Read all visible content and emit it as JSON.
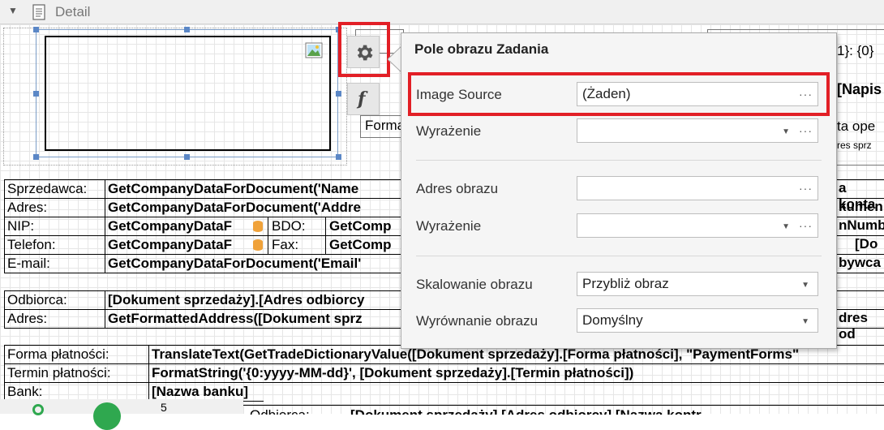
{
  "band": {
    "title": "Detail"
  },
  "right_fragments": {
    "line1": "1}: {0}",
    "line2": "[Napis",
    "line3": "ta ope",
    "line4": "res sprz",
    "r1": "a konta",
    "r2": "kumen",
    "r3": "nNumb",
    "r4": "[Do",
    "r5": "bywca",
    "r6": "dres od",
    "forma": "Forma"
  },
  "seller": {
    "rows": [
      {
        "label": "Sprzedawca:",
        "value": "GetCompanyDataForDocument('Name"
      },
      {
        "label": "Adres:",
        "value": "GetCompanyDataForDocument('Addre"
      },
      {
        "label": "NIP:",
        "value": "GetCompanyDataF",
        "label2": "BDO:",
        "value2": "GetComp"
      },
      {
        "label": "Telefon:",
        "value": "GetCompanyDataF",
        "label2": "Fax:",
        "value2": "GetComp"
      },
      {
        "label": "E-mail:",
        "value": "GetCompanyDataForDocument('Email'"
      }
    ]
  },
  "buyer": {
    "rows": [
      {
        "label": "Odbiorca:",
        "value": "[Dokument sprzedaży].[Adres odbiorcy"
      },
      {
        "label": "Adres:",
        "value": "GetFormattedAddress([Dokument sprz"
      }
    ]
  },
  "payment": {
    "rows": [
      {
        "label": "Forma płatności:",
        "value": "TranslateText(GetTradeDictionaryValue([Dokument sprzedaży].[Forma płatności], \"PaymentForms\""
      },
      {
        "label": "Termin płatności:",
        "value": "FormatString('{0:yyyy-MM-dd}', [Dokument sprzedaży].[Termin płatności])"
      },
      {
        "label": "Bank:",
        "value": "[Nazwa banku]"
      }
    ]
  },
  "bottom": {
    "num": "5",
    "label": "Odbiorca:",
    "value": "[Dokument sprzedaży].[Adres odbiorcy].[Nazwa kontr"
  },
  "popup": {
    "title": "Pole obrazu Zadania",
    "image_source_label": "Image Source",
    "image_source_value": "(Żaden)",
    "expr1_label": "Wyrażenie",
    "image_url_label": "Adres obrazu",
    "expr2_label": "Wyrażenie",
    "scaling_label": "Skalowanie obrazu",
    "scaling_value": "Przybliż obraz",
    "align_label": "Wyrównanie obrazu",
    "align_value": "Domyślny",
    "ellipsis": "···"
  },
  "colors": {
    "highlight": "#e21f26",
    "handle": "#5b87c6"
  }
}
